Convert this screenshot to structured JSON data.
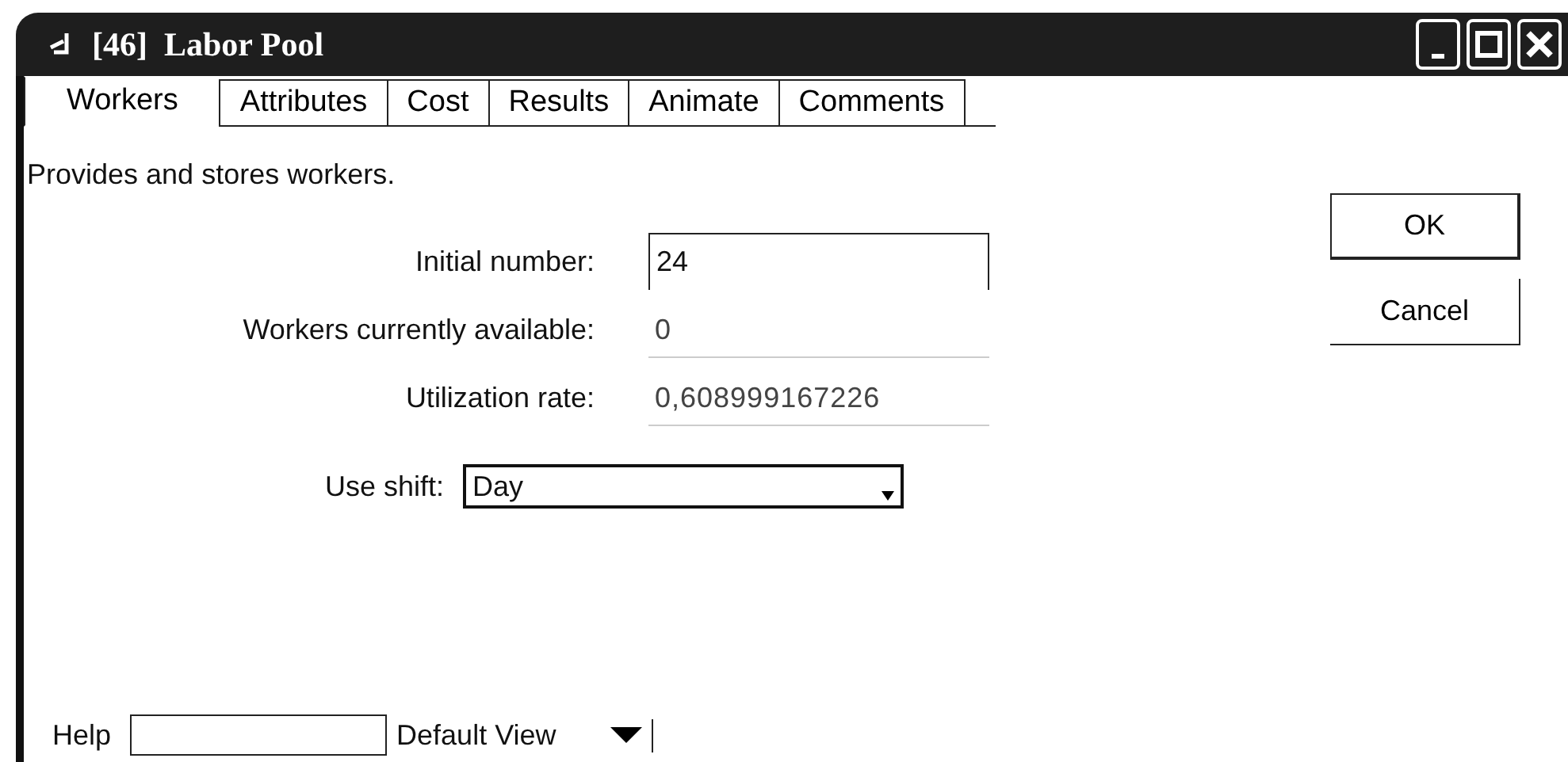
{
  "window": {
    "title": "[46]  Labor Pool"
  },
  "tabs": [
    {
      "label": "Workers",
      "selected": true
    },
    {
      "label": "Attributes",
      "selected": false
    },
    {
      "label": "Cost",
      "selected": false
    },
    {
      "label": "Results",
      "selected": false
    },
    {
      "label": "Animate",
      "selected": false
    },
    {
      "label": "Comments",
      "selected": false
    }
  ],
  "description": "Provides and stores workers.",
  "buttons": [
    {
      "label": "OK",
      "kind": "default"
    },
    {
      "label": "Cancel",
      "kind": "normal"
    }
  ],
  "fields": [
    {
      "label": "Initial number:",
      "value": "24",
      "kind": "input"
    },
    {
      "label": "Workers currently available:",
      "value": "0",
      "kind": "readout"
    },
    {
      "label": "Utilization rate:",
      "value": "0,608999167226",
      "kind": "readout"
    }
  ],
  "shift": {
    "label": "Use shift:",
    "value": "Day"
  },
  "footer": {
    "help_label": "Help",
    "view": "Default View"
  }
}
